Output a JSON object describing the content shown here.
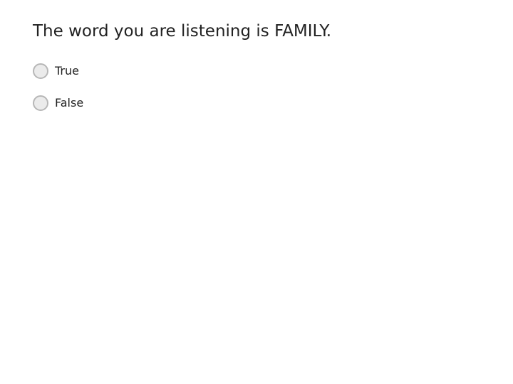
{
  "question": {
    "text": "The word you are listening is FAMILY."
  },
  "options": [
    {
      "label": "True",
      "selected": false
    },
    {
      "label": "False",
      "selected": false
    }
  ],
  "colors": {
    "text": "#222222",
    "radio_border": "#b7b7b7",
    "radio_fill": "#ebebeb",
    "background": "#ffffff"
  }
}
